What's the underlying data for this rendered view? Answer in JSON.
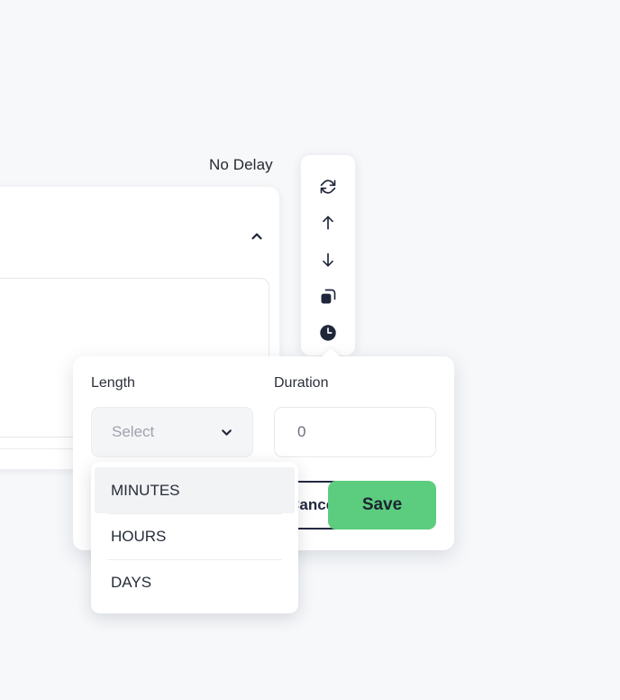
{
  "theme": {
    "background": "#f6f8fa",
    "panel": "#ffffff",
    "text_dark": "#25292e",
    "placeholder": "#9da3ab",
    "accent_green": "#5ccd7f",
    "outline_dark": "#232a41",
    "highlight": "#f2f3f5"
  },
  "canvas": {
    "node_label": "No Delay"
  },
  "background_card": {
    "collapse_icon": "chevron-up-icon"
  },
  "toolbar": {
    "items": [
      {
        "icon": "refresh-icon",
        "active": false
      },
      {
        "icon": "arrow-up-icon",
        "active": false
      },
      {
        "icon": "arrow-down-icon",
        "active": false
      },
      {
        "icon": "copy-icon",
        "active": false
      },
      {
        "icon": "clock-icon",
        "active": true
      }
    ]
  },
  "delay_popup": {
    "length": {
      "label": "Length",
      "value": "",
      "placeholder": "Select",
      "chevron_icon": "chevron-down-icon"
    },
    "duration": {
      "label": "Duration",
      "value": "0",
      "placeholder": "0"
    },
    "cancel_label": "Cancel",
    "save_label": "Save"
  },
  "dropdown": {
    "options": [
      {
        "label": "MINUTES",
        "highlighted": true
      },
      {
        "label": "HOURS",
        "highlighted": false
      },
      {
        "label": "DAYS",
        "highlighted": false
      }
    ]
  }
}
